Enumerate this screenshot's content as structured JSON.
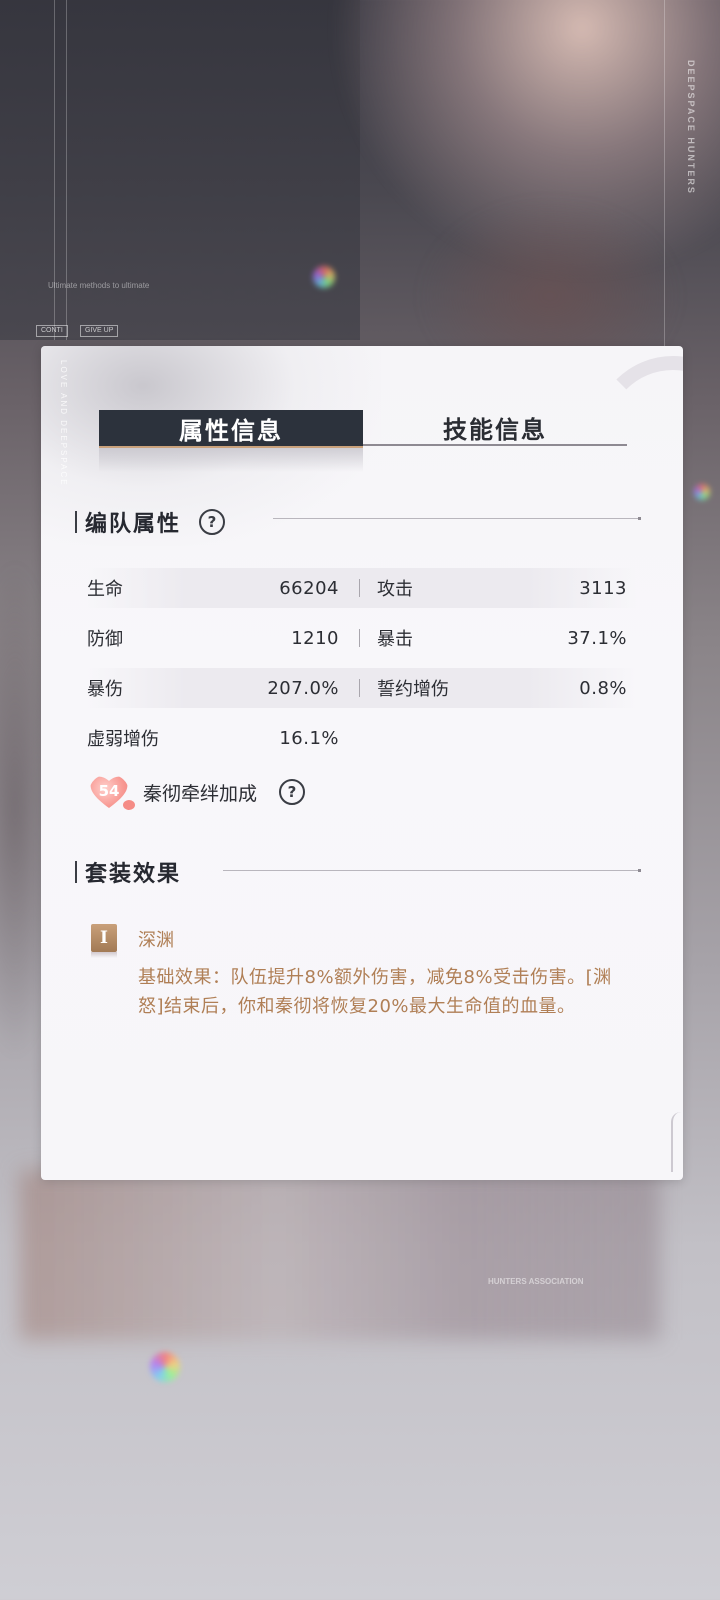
{
  "background": {
    "brand_vertical": "DEEPSPACE HUNTERS",
    "small_text": "Ultimate methods to ultimate",
    "tags": [
      "CONTI",
      "GIVE UP"
    ],
    "hunters_association": "HUNTERS ASSOCIATION"
  },
  "panel": {
    "vertical_text": "LOVE AND DEEPSPACE"
  },
  "tabs": [
    {
      "label": "属性信息",
      "active": true
    },
    {
      "label": "技能信息",
      "active": false
    }
  ],
  "team_attributes": {
    "title": "编队属性",
    "help_icon": "question-icon",
    "stats": [
      {
        "label": "生命",
        "value": "66204"
      },
      {
        "label": "攻击",
        "value": "3113"
      },
      {
        "label": "防御",
        "value": "1210"
      },
      {
        "label": "暴击",
        "value": "37.1%"
      },
      {
        "label": "暴伤",
        "value": "207.0%"
      },
      {
        "label": "誓约增伤",
        "value": "0.8%"
      },
      {
        "label": "虚弱增伤",
        "value": "16.1%"
      }
    ]
  },
  "bond": {
    "level": "54",
    "label": "秦彻牵绊加成",
    "icon": "heart-icon"
  },
  "set_effect": {
    "title": "套装效果",
    "tier_badge": "I",
    "name": "深渊",
    "description": "基础效果：队伍提升8%额外伤害，减免8%受击伤害。[渊怒]结束后，你和秦彻将恢复20%最大生命值的血量。"
  },
  "colors": {
    "tab_active_bg": "#2c323c",
    "accent_bronze": "#b07f56",
    "text_dark": "#2c2e34",
    "bond_heart": "#f58c86"
  }
}
